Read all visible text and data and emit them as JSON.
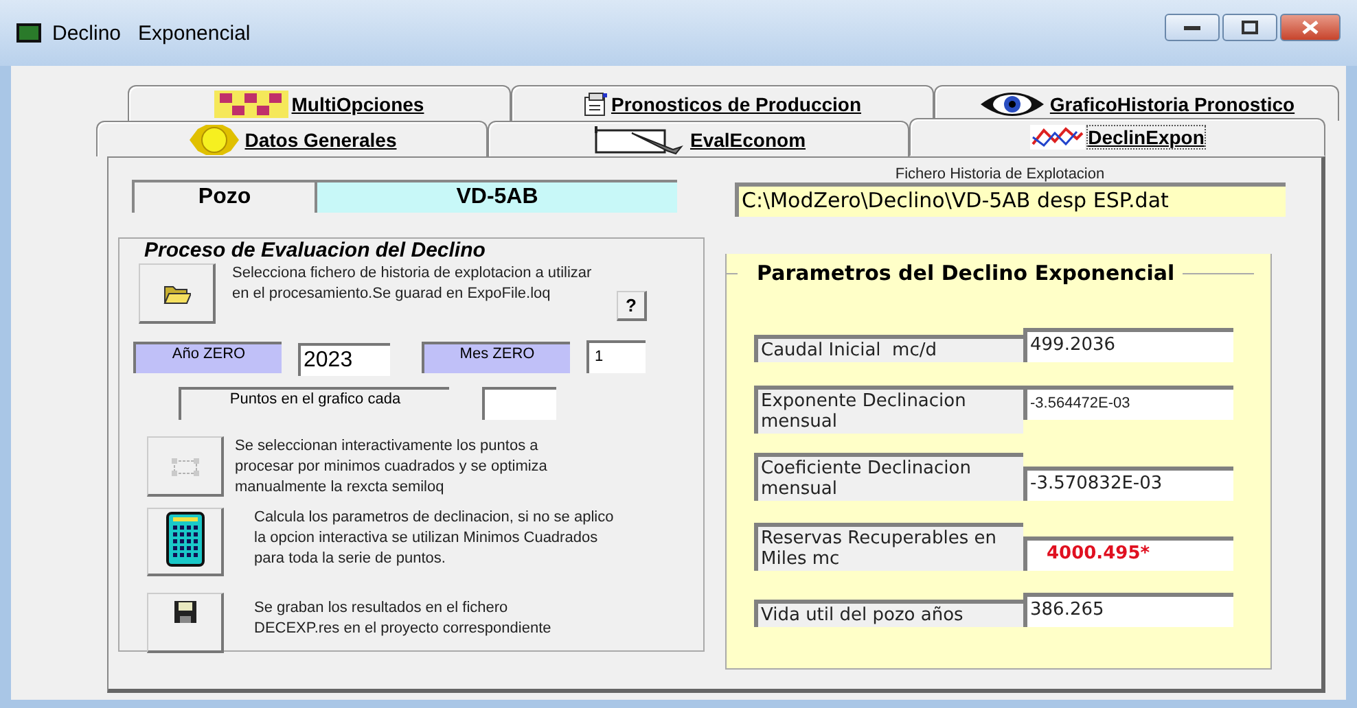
{
  "window": {
    "title": "Declino   Exponencial"
  },
  "tab_rows": [
    {
      "tabs": [
        {
          "label": "MultiOpciones",
          "kind": "squares",
          "selected": false
        },
        {
          "label": "Pronosticos de Produccion",
          "kind": "document",
          "selected": false
        },
        {
          "label": "GraficoHistoria Pronostico",
          "kind": "eye",
          "selected": false
        }
      ]
    },
    {
      "tabs": [
        {
          "label": "Datos Generales",
          "kind": "sun",
          "selected": false
        },
        {
          "label": "EvalEconom",
          "kind": "notebook",
          "selected": false
        },
        {
          "label": "DeclinExpon",
          "kind": "chart",
          "selected": true
        }
      ]
    }
  ],
  "well": {
    "label": "Pozo",
    "value": "VD-5AB"
  },
  "history_file": {
    "label": "Fichero Historia de Explotacion",
    "value": "C:\\ModZero\\Declino\\VD-5AB desp ESP.dat"
  },
  "process": {
    "title": "Proceso de Evaluacion del Declino",
    "help_button": "?",
    "year": {
      "label": "Año ZERO",
      "value": "2023"
    },
    "month": {
      "label": "Mes ZERO",
      "value": "1"
    },
    "points": {
      "label": "Puntos en el grafico cada"
    },
    "actions": [
      {
        "kind": "open",
        "disabled": false,
        "text": "Selecciona fichero de historia de explotacion a utilizar en el procesamiento.Se guarad en ExpoFile.loq"
      },
      {
        "kind": "select",
        "disabled": true,
        "text": "Se seleccionan interactivamente los puntos a procesar por minimos cuadrados y se optimiza manualmente la rexcta semiloq"
      },
      {
        "kind": "calculate",
        "disabled": false,
        "text": "Calcula los parametros de declinacion, si no se aplico la opcion interactiva se  utilizan Minimos Cuadrados para toda la serie de puntos."
      },
      {
        "kind": "save",
        "disabled": false,
        "text": "Se graban los resultados en el fichero DECEXP.res en el proyecto correspondiente"
      }
    ]
  },
  "parameters": {
    "title": "Parametros del Declino Exponencial",
    "rows": [
      {
        "label": "Caudal Inicial  mc/d",
        "value": "499.2036",
        "alert": false
      },
      {
        "label": "Exponente Declinacion mensual",
        "value": "-3.564472E-03",
        "alert": false
      },
      {
        "label": "Coeficiente Declinacion mensual",
        "value": "-3.570832E-03",
        "alert": false
      },
      {
        "label": "Reservas Recuperables en Miles mc",
        "value": "4000.495*",
        "alert": true
      },
      {
        "label": "Vida util del pozo años",
        "value": "386.265",
        "alert": false
      }
    ]
  }
}
